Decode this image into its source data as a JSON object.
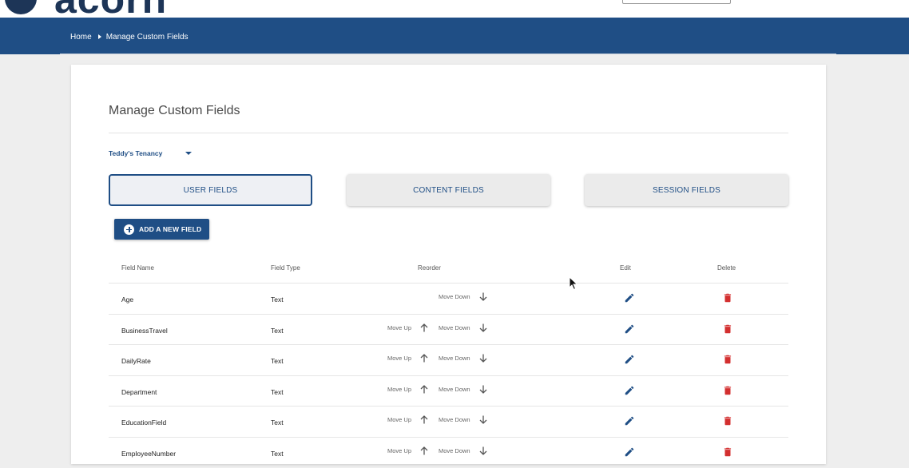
{
  "header": {
    "logo_text": "acorn",
    "breadcrumb": [
      {
        "label": "Home"
      },
      {
        "label": "Manage Custom Fields"
      }
    ]
  },
  "page": {
    "title": "Manage Custom Fields",
    "tenancy_selector": "Teddy's Tenancy",
    "tabs": [
      {
        "label": "USER FIELDS",
        "active": true
      },
      {
        "label": "CONTENT FIELDS",
        "active": false
      },
      {
        "label": "SESSION FIELDS",
        "active": false
      }
    ],
    "add_button_label": "ADD A NEW FIELD"
  },
  "table": {
    "columns": [
      "Field Name",
      "Field Type",
      "Reorder",
      "Edit",
      "Delete"
    ],
    "move_up_label": "Move Up",
    "move_down_label": "Move Down",
    "rows": [
      {
        "name": "Age",
        "type": "Text",
        "can_move_up": false,
        "can_move_down": true
      },
      {
        "name": "BusinessTravel",
        "type": "Text",
        "can_move_up": true,
        "can_move_down": true
      },
      {
        "name": "DailyRate",
        "type": "Text",
        "can_move_up": true,
        "can_move_down": true
      },
      {
        "name": "Department",
        "type": "Text",
        "can_move_up": true,
        "can_move_down": true
      },
      {
        "name": "EducationField",
        "type": "Text",
        "can_move_up": true,
        "can_move_down": true
      },
      {
        "name": "EmployeeNumber",
        "type": "Text",
        "can_move_up": true,
        "can_move_down": true
      }
    ]
  },
  "icons": {
    "edit": "pencil-icon",
    "delete": "trash-icon",
    "move_up": "arrow-up-icon",
    "move_down": "arrow-down-icon",
    "add": "plus-circle-icon",
    "tenancy_dropdown": "caret-down-icon"
  },
  "colors": {
    "brand_blue": "#1f4e85",
    "delete_red": "#d32f2f",
    "logo_navy": "#1d3557"
  }
}
